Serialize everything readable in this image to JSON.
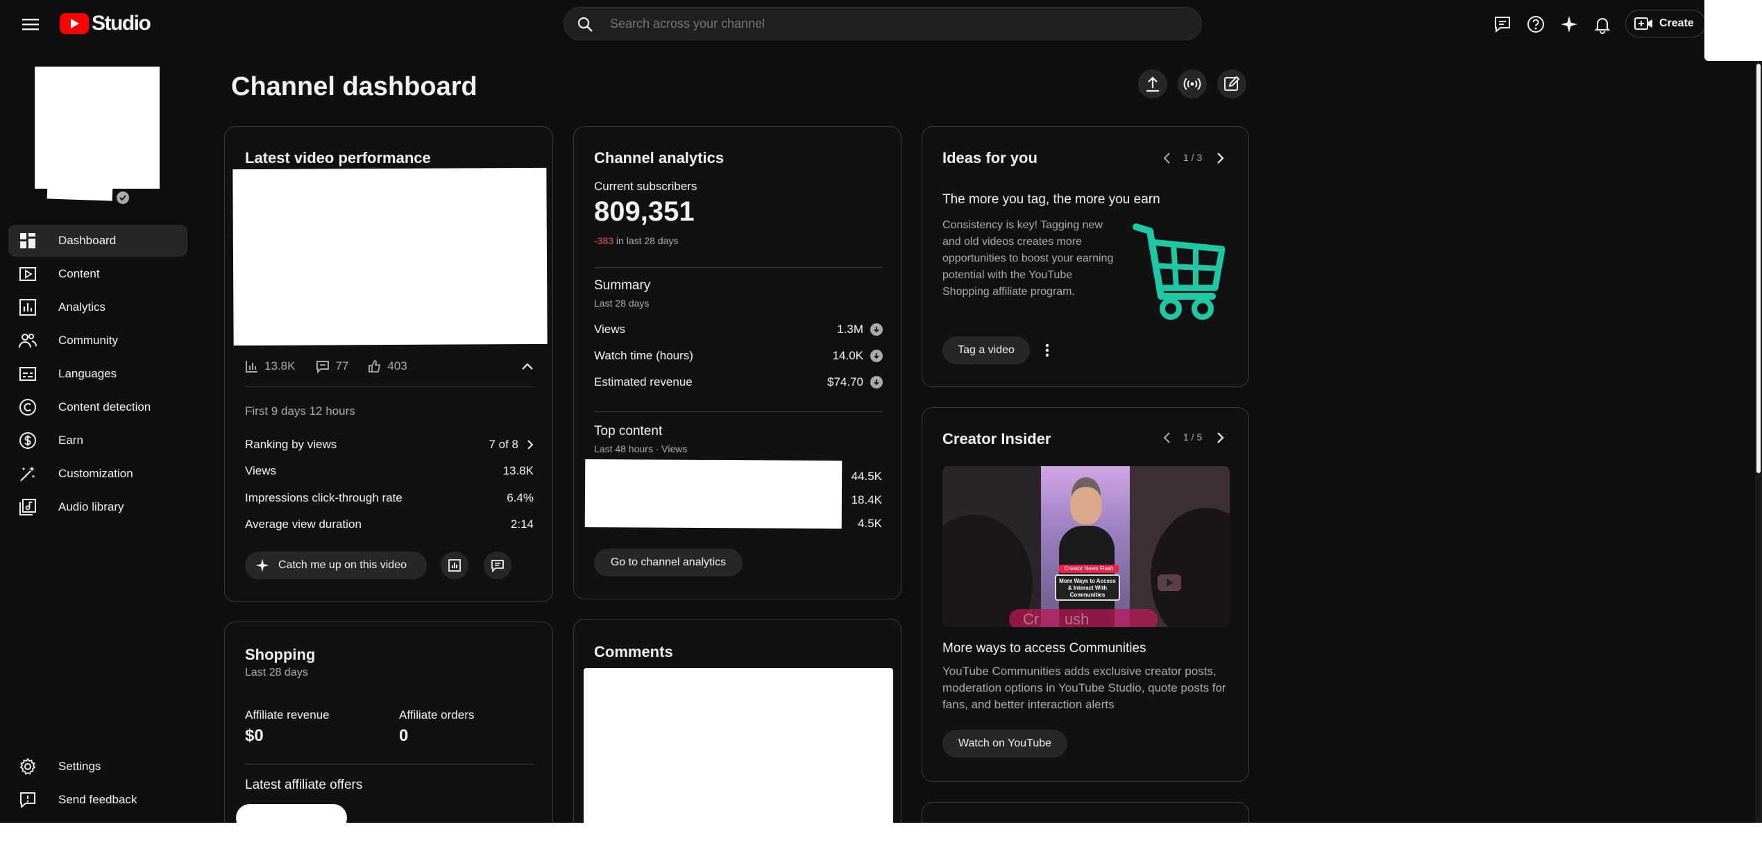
{
  "app": {
    "logo_text": "Studio",
    "brand_color": "#ff0000"
  },
  "search": {
    "placeholder": "Search across your channel"
  },
  "header": {
    "create_label": "Create"
  },
  "page": {
    "title": "Channel dashboard"
  },
  "sidebar": {
    "items": [
      {
        "label": "Dashboard",
        "icon": "dashboard-icon",
        "active": true
      },
      {
        "label": "Content",
        "icon": "content-icon"
      },
      {
        "label": "Analytics",
        "icon": "analytics-icon"
      },
      {
        "label": "Community",
        "icon": "community-icon"
      },
      {
        "label": "Languages",
        "icon": "languages-icon"
      },
      {
        "label": "Content detection",
        "icon": "copyright-icon"
      },
      {
        "label": "Earn",
        "icon": "dollar-icon"
      },
      {
        "label": "Customization",
        "icon": "magic-wand-icon"
      },
      {
        "label": "Audio library",
        "icon": "audio-library-icon"
      }
    ],
    "settings_label": "Settings",
    "feedback_label": "Send feedback"
  },
  "latest_video": {
    "title": "Latest video performance",
    "stats": {
      "views": "13.8K",
      "comments": "77",
      "likes": "403"
    },
    "period": "First 9 days 12 hours",
    "rows": [
      {
        "label": "Ranking by views",
        "value": "7 of 8"
      },
      {
        "label": "Views",
        "value": "13.8K"
      },
      {
        "label": "Impressions click-through rate",
        "value": "6.4%"
      },
      {
        "label": "Average view duration",
        "value": "2:14"
      }
    ],
    "catch_me_up_label": "Catch me up on this video"
  },
  "analytics": {
    "title": "Channel analytics",
    "subs_label": "Current subscribers",
    "subs_value": "809,351",
    "subs_change": "-383",
    "subs_change_suffix": "in last 28 days",
    "negative_color": "#ff4e45",
    "summary_title": "Summary",
    "summary_period": "Last 28 days",
    "summary_rows": [
      {
        "label": "Views",
        "value": "1.3M"
      },
      {
        "label": "Watch time (hours)",
        "value": "14.0K"
      },
      {
        "label": "Estimated revenue",
        "value": "$74.70"
      }
    ],
    "top_title": "Top content",
    "top_period": "Last 48 hours · Views",
    "top_values": [
      "44.5K",
      "18.4K",
      "4.5K"
    ],
    "go_label": "Go to channel analytics"
  },
  "ideas": {
    "title": "Ideas for you",
    "pager": "1 / 3",
    "headline": "The more you tag, the more you earn",
    "body": "Consistency is key! Tagging new and old videos creates more opportunities to boost your earning potential with the YouTube Shopping affiliate program.",
    "tag_label": "Tag a video",
    "accent": "#1ec8a5"
  },
  "insider": {
    "title": "Creator Insider",
    "pager": "1 / 5",
    "video_title": "More ways to access Communities",
    "video_desc": "YouTube Communities adds exclusive creator posts, moderation options in YouTube Studio, quote posts for fans, and better interaction alerts",
    "watch_label": "Watch on YouTube",
    "thumb_badge": "Creator News Flash",
    "thumb_caption": "More Ways to Access & Interact With Communities",
    "thumb_bg_text": "Cr      ush"
  },
  "shopping": {
    "title": "Shopping",
    "period": "Last 28 days",
    "revenue_label": "Affiliate revenue",
    "revenue_value": "$0",
    "orders_label": "Affiliate orders",
    "orders_value": "0",
    "offers_title": "Latest affiliate offers"
  },
  "comments": {
    "title": "Comments"
  }
}
